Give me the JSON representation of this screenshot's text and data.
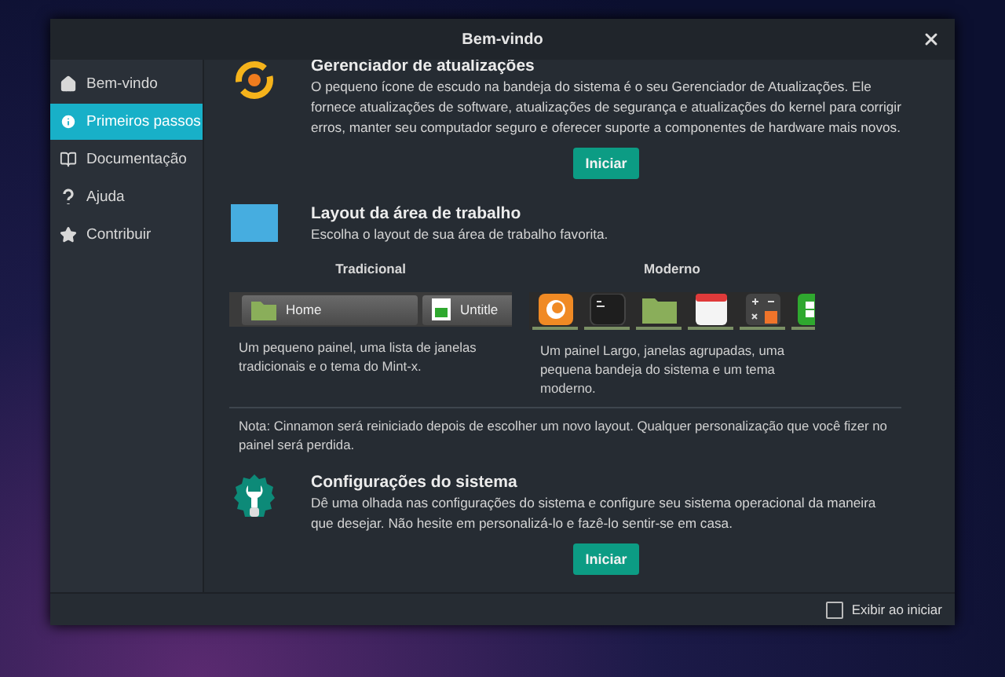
{
  "window": {
    "title": "Bem-vindo"
  },
  "sidebar": {
    "items": [
      {
        "label": "Bem-vindo",
        "selected": false
      },
      {
        "label": "Primeiros passos",
        "selected": true
      },
      {
        "label": "Documentação",
        "selected": false
      },
      {
        "label": "Ajuda",
        "selected": false
      },
      {
        "label": "Contribuir",
        "selected": false
      }
    ]
  },
  "update_manager": {
    "title": "Gerenciador de atualizações",
    "text": "O pequeno ícone de escudo na bandeja do sistema é o seu Gerenciador de Atualizações. Ele fornece atualizações de software, atualizações de segurança e atualizações do kernel para corrigir erros, manter seu computador seguro e oferecer suporte a componentes de hardware mais novos.",
    "button": "Iniciar"
  },
  "layout": {
    "title": "Layout da área de trabalho",
    "text": "Escolha o layout de sua área de trabalho favorita.",
    "options": [
      {
        "kind": "traditional",
        "name": "Tradicional",
        "panel_items": [
          "Home",
          "Untitle"
        ],
        "description": "Um pequeno painel, uma lista de janelas tradicionais e o tema do Mint-x."
      },
      {
        "kind": "modern",
        "name": "Moderno",
        "description": "Um painel Largo, janelas agrupadas, uma pequena bandeja do sistema e um tema moderno."
      }
    ],
    "note": "Nota: Cinnamon será reiniciado depois de escolher um novo layout. Qualquer personalização que você fizer no painel será perdida."
  },
  "system_settings": {
    "title": "Configurações do sistema",
    "text": "Dê uma olhada nas configurações do sistema e configure seu sistema operacional da maneira que desejar. Não hesite em personalizá-lo e fazê-lo sentir-se em casa.",
    "button": "Iniciar"
  },
  "footer": {
    "show_at_startup": {
      "label": "Exibir ao iniciar",
      "checked": false
    }
  }
}
